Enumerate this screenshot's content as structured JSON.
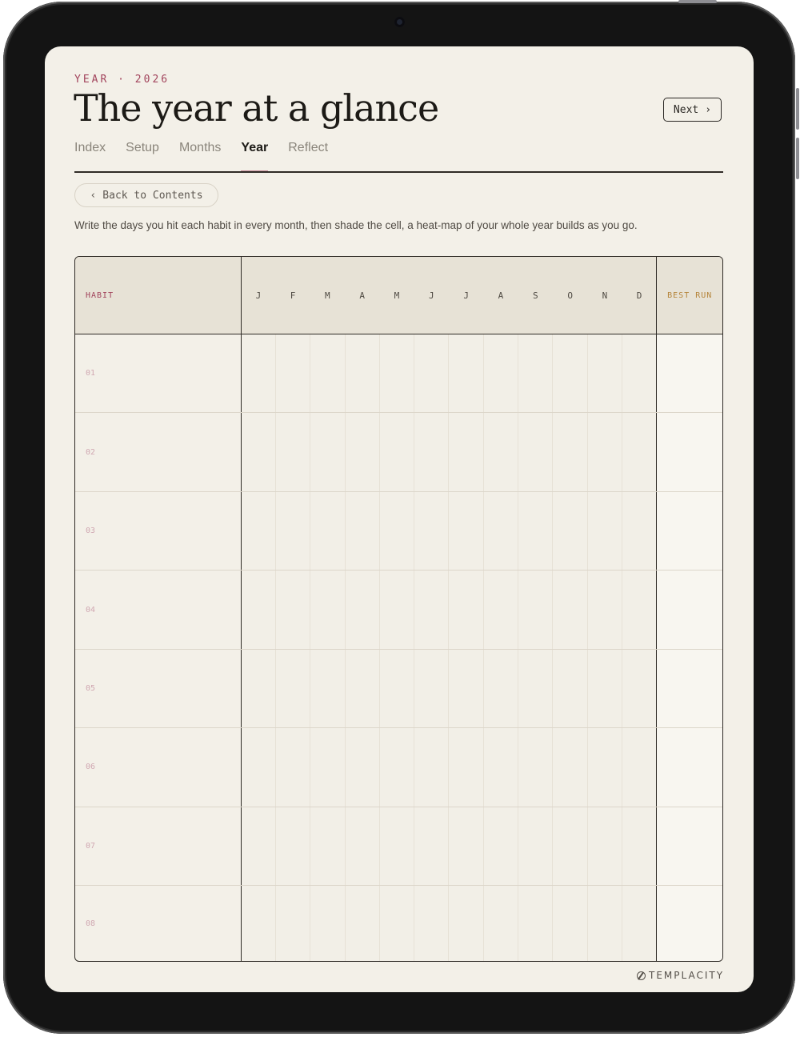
{
  "header": {
    "eyebrow": "YEAR · 2026",
    "title": "The year at a glance",
    "next_label": "Next",
    "next_icon": "›"
  },
  "tabs": [
    {
      "label": "Index",
      "active": false
    },
    {
      "label": "Setup",
      "active": false
    },
    {
      "label": "Months",
      "active": false
    },
    {
      "label": "Year",
      "active": true
    },
    {
      "label": "Reflect",
      "active": false
    }
  ],
  "back_button": {
    "icon": "‹",
    "label": "Back to Contents"
  },
  "description": "Write the days you hit each habit in every month, then shade the cell, a heat-map of your whole year builds as you go.",
  "grid": {
    "habit_header": "HABIT",
    "months": [
      "J",
      "F",
      "M",
      "A",
      "M",
      "J",
      "J",
      "A",
      "S",
      "O",
      "N",
      "D"
    ],
    "best_header": "BEST RUN",
    "rows": [
      "01",
      "02",
      "03",
      "04",
      "05",
      "06",
      "07",
      "08"
    ]
  },
  "brand": "TEMPLACITY",
  "colors": {
    "accent": "#a2445c",
    "gold": "#b5843a",
    "paper": "#f3f0e8",
    "ink": "#1c1a16",
    "bezel": "#141414"
  }
}
